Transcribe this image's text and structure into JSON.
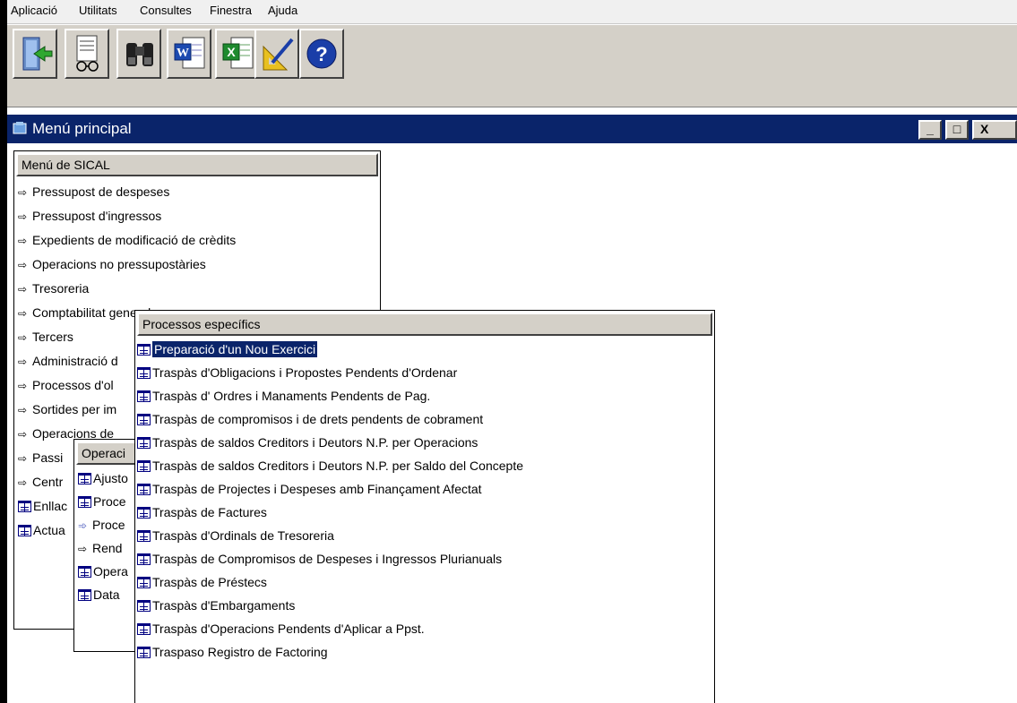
{
  "menu": [
    "Aplicació",
    "Utilitats",
    "Consultes",
    "Finestra",
    "Ajuda"
  ],
  "toolbar": {
    "buttons": [
      "exit-icon",
      "preview-icon",
      "binoculars-icon",
      "word-icon",
      "excel-icon",
      "design-icon",
      "help-icon"
    ],
    "help_glyph": "?"
  },
  "window": {
    "title": "Menú principal",
    "minimize": "_",
    "maximize": "□",
    "close": "X"
  },
  "main_menu": {
    "header": "Menú de SICAL",
    "items": [
      {
        "label": "Pressupost de despeses",
        "icon": "arrow"
      },
      {
        "label": "Pressupost d'ingressos",
        "icon": "arrow"
      },
      {
        "label": "Expedients de modificació de crèdits",
        "icon": "arrow"
      },
      {
        "label": "Operacions no pressupostàries",
        "icon": "arrow"
      },
      {
        "label": "Tresoreria",
        "icon": "arrow"
      },
      {
        "label": "Comptabilitat general",
        "icon": "arrow"
      },
      {
        "label": "Tercers",
        "icon": "arrow"
      },
      {
        "label": "Administració d",
        "icon": "arrow"
      },
      {
        "label": "Processos d'ol",
        "icon": "arrow"
      },
      {
        "label": "Sortides per im",
        "icon": "arrow"
      },
      {
        "label": "Operacions de",
        "icon": "arrow"
      },
      {
        "label": "Passi",
        "icon": "arrow"
      },
      {
        "label": "Centr",
        "icon": "arrow"
      },
      {
        "label": "Enllac",
        "icon": "form"
      },
      {
        "label": "Actua",
        "icon": "form"
      }
    ]
  },
  "sub_menu": {
    "header": "Operaci",
    "items": [
      {
        "label": "Ajusto",
        "icon": "form"
      },
      {
        "label": "Proce",
        "icon": "form"
      },
      {
        "label": "Proce",
        "icon": "arrow-active"
      },
      {
        "label": "Rend",
        "icon": "arrow"
      },
      {
        "label": "Opera",
        "icon": "form"
      },
      {
        "label": "Data",
        "icon": "form"
      }
    ]
  },
  "specific_menu": {
    "header": "Processos específics",
    "items": [
      "Preparació d'un Nou Exercici",
      "Traspàs d'Obligacions i Propostes Pendents d'Ordenar",
      "Traspàs d' Ordres i Manaments Pendents de Pag.",
      "Traspàs de compromisos i de drets pendents de cobrament",
      "Traspàs de saldos Creditors i Deutors N.P. per Operacions",
      "Traspàs de saldos Creditors i Deutors N.P. per Saldo del Concepte",
      "Traspàs de Projectes i Despeses amb Finançament Afectat",
      "Traspàs de Factures",
      "Traspàs d'Ordinals de Tresoreria",
      "Traspàs de Compromisos de Despeses i Ingressos Plurianuals",
      "Traspàs de Préstecs",
      "Traspàs d'Embargaments",
      "Traspàs d'Operacions Pendents d'Aplicar a Ppst.",
      "Traspaso Registro de Factoring"
    ],
    "selected_index": 0
  }
}
